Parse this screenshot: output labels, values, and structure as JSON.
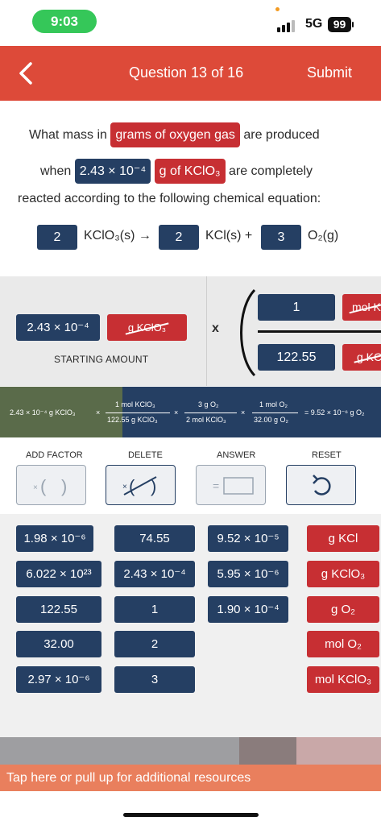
{
  "status_bar": {
    "time": "9:03",
    "network": "5G",
    "battery": "99"
  },
  "header": {
    "title": "Question 13 of 16",
    "submit_label": "Submit"
  },
  "question": {
    "line1_pre": "What mass in",
    "line1_pill": "grams of oxygen gas",
    "line1_post": "are produced",
    "line2_pre": "when",
    "line2_blue": "2.43 × 10⁻⁴",
    "line2_red": "g of KClO₃",
    "line2_post": "are completely",
    "line3": "reacted according to the following chemical equation:"
  },
  "equation": {
    "coef1": "2",
    "reactant": "KClO₃(s) →",
    "coef2": "2",
    "product1": "KCl(s) +",
    "coef3": "3",
    "product2": "O₂(g)"
  },
  "workspace": {
    "starting_value": "2.43 × 10⁻⁴",
    "starting_unit": "g KClO₃",
    "starting_label": "STARTING AMOUNT",
    "times": "x",
    "factor_num_value": "1",
    "factor_num_unit": "mol K",
    "factor_den_value": "122.55",
    "factor_den_unit": "g KC"
  },
  "calculation": {
    "start": "2.43 × 10⁻⁴ g KClO₃",
    "x": "×",
    "f1_num": "1 mol KClO₃",
    "f1_den": "122.55 g KClO₃",
    "f2_num": "3 g O₂",
    "f2_den": "2 mol KClO₃",
    "f3_num": "1 mol O₂",
    "f3_den": "32.00 g O₂",
    "result": "= 9.52 × 10⁻⁶ g O₂"
  },
  "controls": {
    "add_factor": "ADD FACTOR",
    "delete": "DELETE",
    "answer": "ANSWER",
    "reset": "RESET"
  },
  "tiles": {
    "col1": [
      "1.98 × 10⁻⁶",
      "6.022 × 10²³",
      "122.55",
      "32.00",
      "2.97 × 10⁻⁶"
    ],
    "col2": [
      "74.55",
      "2.43 × 10⁻⁴",
      "1",
      "2",
      "3"
    ],
    "col3": [
      "9.52 × 10⁻⁵",
      "5.95 × 10⁻⁶",
      "1.90 × 10⁻⁴"
    ],
    "units": [
      "g KCl",
      "g KClO₃",
      "g O₂",
      "mol O₂",
      "mol KClO₃"
    ]
  },
  "footer": {
    "resources": "Tap here or pull up for additional resources"
  },
  "colors": {
    "accent_red": "#dd4a39",
    "tile_blue": "#253f63",
    "tile_red": "#c72f33",
    "status_green": "#35c759"
  }
}
